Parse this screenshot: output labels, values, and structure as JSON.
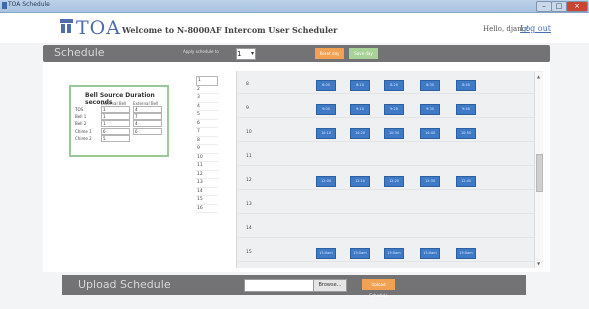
{
  "window": {
    "title": "TOA Schedule"
  },
  "header": {
    "brand": "TOA",
    "welcome": "Welcome to N-8000AF Intercom User Scheduler",
    "hello": "Hello, djang!",
    "logout": "Log out"
  },
  "schedule": {
    "title": "Schedule",
    "copy_label": "Apply schedule to",
    "copy_value": "1",
    "orange_btn": "Reset day",
    "green_btn": "Save day"
  },
  "bell_panel": {
    "title": "Bell Source Duration seconds",
    "col1": "External Bell",
    "col2": "External Bell",
    "rows": [
      {
        "label": "TOS",
        "v1": "1",
        "v2": "4"
      },
      {
        "label": "Bell 1",
        "v1": "1",
        "v2": "7"
      },
      {
        "label": "Bell 2",
        "v1": "1",
        "v2": "4"
      },
      {
        "label": "Chime 1",
        "v1": "6",
        "v2": "6"
      },
      {
        "label": "Chime 2",
        "v1": "5",
        "v2": ""
      }
    ]
  },
  "hour_list": [
    "1",
    "2",
    "3",
    "4",
    "5",
    "6",
    "7",
    "8",
    "9",
    "10",
    "11",
    "12",
    "13",
    "14",
    "15",
    "16"
  ],
  "grid_rows": [
    {
      "label": "8",
      "buttons": [
        "8:00",
        "8:10",
        "8:20",
        "8:30",
        "8:40"
      ]
    },
    {
      "label": "9",
      "buttons": [
        "9:00",
        "9:10",
        "9:20",
        "9:30",
        "9:40"
      ]
    },
    {
      "label": "10",
      "buttons": [
        "10:10",
        "10:20",
        "10:30",
        "10:40",
        "10:50"
      ]
    },
    {
      "label": "11",
      "buttons": []
    },
    {
      "label": "12",
      "buttons": [
        "12:00",
        "12:10",
        "12:20",
        "12:30",
        "12:40"
      ]
    },
    {
      "label": "13",
      "buttons": []
    },
    {
      "label": "14",
      "buttons": []
    },
    {
      "label": "15",
      "buttons": [
        "15:0am",
        "15:0am",
        "15:0am",
        "15:0am",
        "15:0am"
      ]
    }
  ],
  "upload": {
    "title": "Upload Schedule",
    "file_value": "",
    "browse": "Browse...",
    "upload_btn": "Upload Schedule"
  },
  "colors": {
    "accent_blue": "#3f7ac7",
    "orange": "#f2a052",
    "green": "#a9d299",
    "bar_gray": "#737375"
  }
}
